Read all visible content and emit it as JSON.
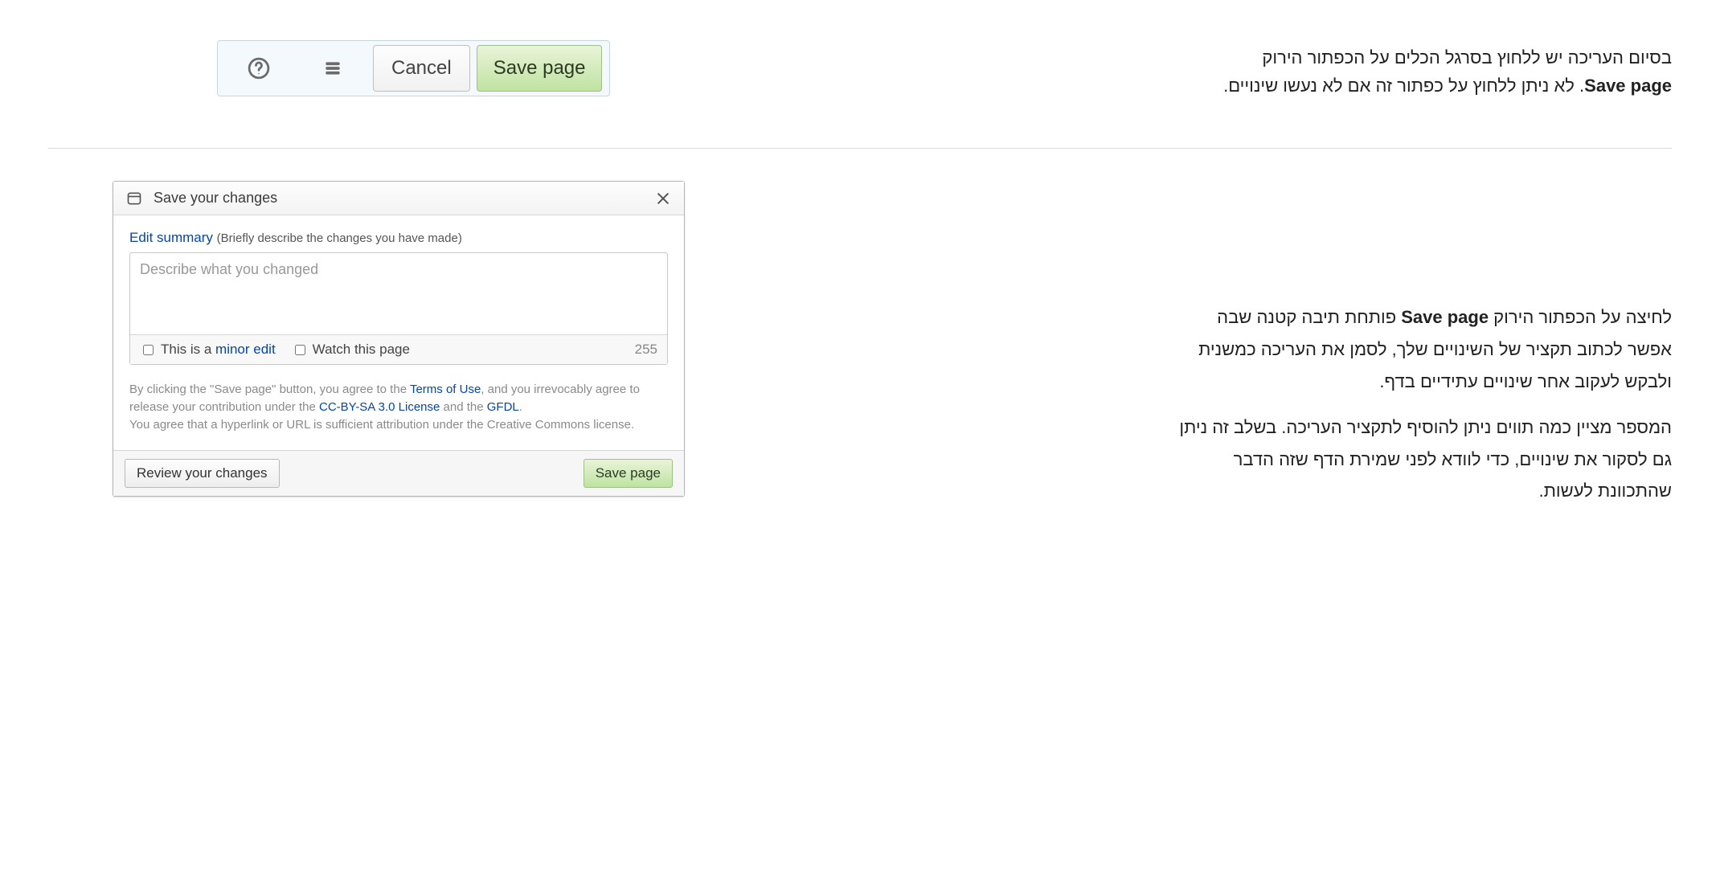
{
  "section1": {
    "hebrew_line1": "בסיום העריכה יש ללחוץ בסרגל הכלים על הכפתור הירוק",
    "hebrew_line2_bold": "Save page",
    "hebrew_line2_rest": ". לא ניתן ללחוץ על כפתור זה אם לא נעשו שינויים.",
    "toolbar": {
      "help_name": "help-icon",
      "menu_name": "menu-icon",
      "cancel": "Cancel",
      "save": "Save page"
    }
  },
  "dialog": {
    "title": "Save your changes",
    "summary_link": "Edit summary",
    "summary_hint": "(Briefly describe the changes you have made)",
    "summary_placeholder": "Describe what you changed",
    "minor_prefix": "This is a ",
    "minor_link": "minor edit",
    "watch_label": "Watch this page",
    "counter": "255",
    "legal_p1a": "By clicking the \"Save page\" button, you agree to the ",
    "legal_link_terms": "Terms of Use",
    "legal_p1b": ", and you irrevocably agree to release your contribution under the ",
    "legal_link_cc": "CC-BY-SA 3.0 License",
    "legal_p1c": " and the ",
    "legal_link_gfdl": "GFDL",
    "legal_p1d": ".",
    "legal_p2": "You agree that a hyperlink or URL is sufficient attribution under the Creative Commons license.",
    "review": "Review your changes",
    "save": "Save page"
  },
  "section2": {
    "p1_a": "לחיצה על הכפתור הירוק ",
    "p1_bold": "Save page",
    "p1_b": " פותחת תיבה קטנה שבה אפשר לכתוב תקציר של השינויים שלך, לסמן את העריכה כמשנית ולבקש לעקוב אחר שינויים עתידיים בדף.",
    "p2": "המספר מציין כמה תווים ניתן להוסיף לתקציר העריכה. בשלב זה ניתן גם לסקור את שינויים, כדי לוודא לפני שמירת הדף שזה הדבר שהתכוונת לעשות."
  }
}
